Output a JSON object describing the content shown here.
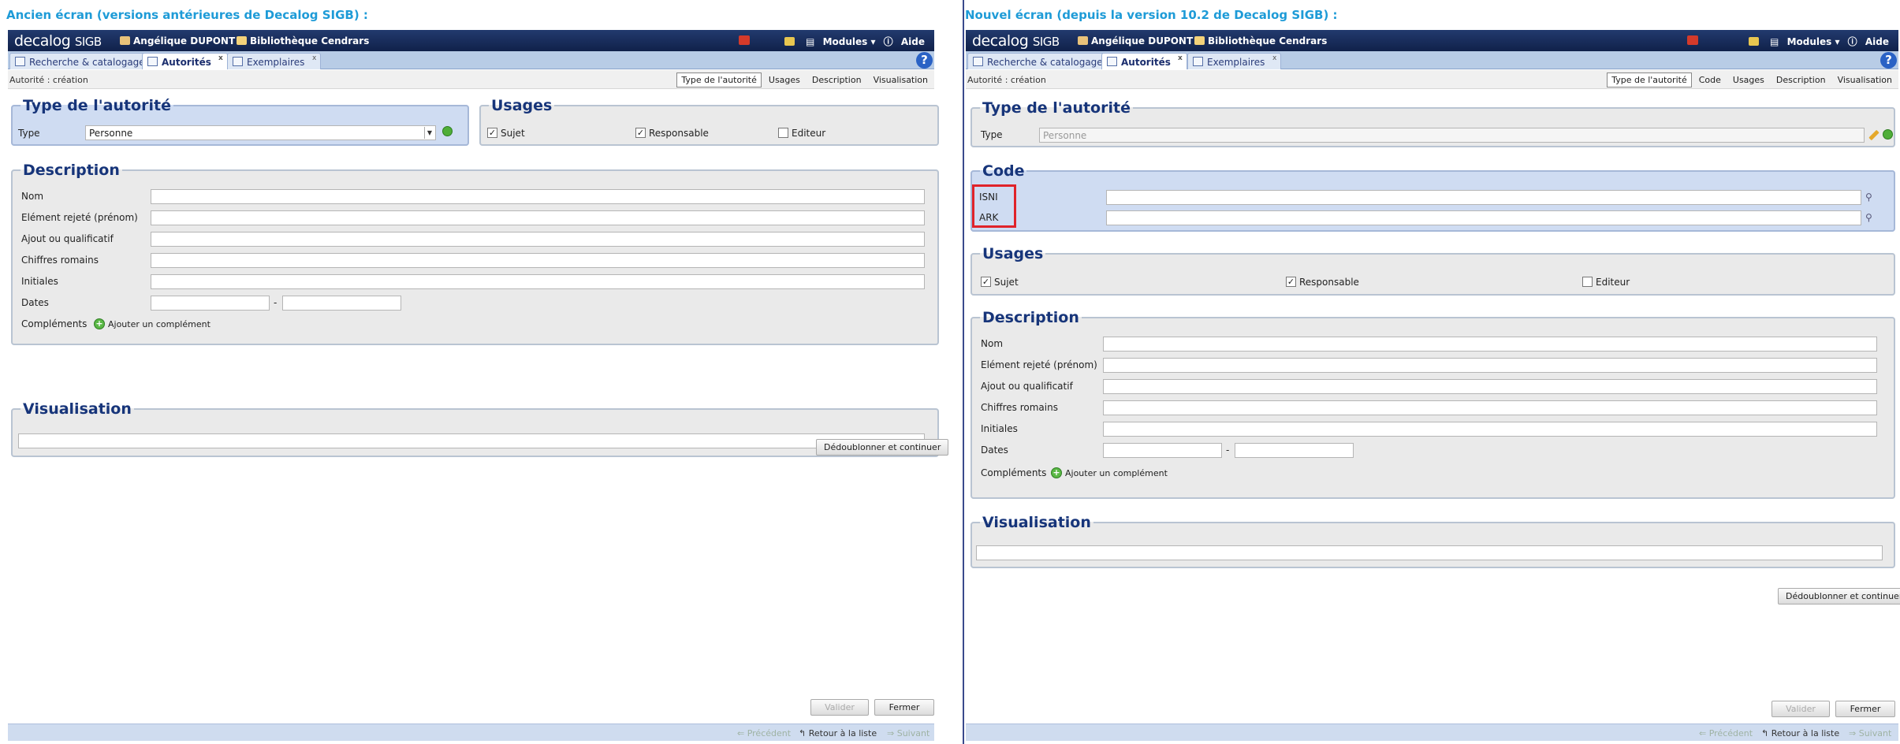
{
  "captions": {
    "old": "Ancien écran (versions antérieures de Decalog SIGB) :",
    "new": "Nouvel écran (depuis la version 10.2 de Decalog SIGB) :"
  },
  "header": {
    "logo": "decalog",
    "logo_sub": "SIGB",
    "user": "Angélique DUPONT",
    "library": "Bibliothèque Cendrars",
    "modules": "Modules",
    "help": "Aide",
    "help_icon": "?"
  },
  "tabs": {
    "search": "Recherche & catalogage",
    "authorities": "Autorités",
    "items": "Exemplaires",
    "close_mark": "x"
  },
  "subbar": {
    "crumb": "Autorité : création",
    "anchors_old": [
      "Type de l'autorité",
      "Usages",
      "Description",
      "Visualisation"
    ],
    "anchors_new": [
      "Type de l'autorité",
      "Code",
      "Usages",
      "Description",
      "Visualisation"
    ]
  },
  "type_section": {
    "title": "Type de l'autorité",
    "label": "Type",
    "value": "Personne"
  },
  "code_section": {
    "title": "Code",
    "isni": "ISNI",
    "ark": "ARK"
  },
  "usages": {
    "title": "Usages",
    "items": [
      {
        "label": "Sujet",
        "checked": true
      },
      {
        "label": "Responsable",
        "checked": true
      },
      {
        "label": "Editeur",
        "checked": false
      }
    ]
  },
  "description": {
    "title": "Description",
    "fields": [
      "Nom",
      "Elément rejeté (prénom)",
      "Ajout ou qualificatif",
      "Chiffres romains",
      "Initiales"
    ],
    "dates_label": "Dates",
    "dates_sep": "-",
    "complements_label": "Compléments",
    "add_complement": "Ajouter un complément",
    "add_icon": "+"
  },
  "visualisation": {
    "title": "Visualisation"
  },
  "buttons": {
    "dedup": "Dédoublonner et continuer",
    "validate": "Valider",
    "close": "Fermer"
  },
  "footer": {
    "previous": "⇐ Précédent",
    "back": "Retour à la liste",
    "next": "⇒ Suivant"
  }
}
